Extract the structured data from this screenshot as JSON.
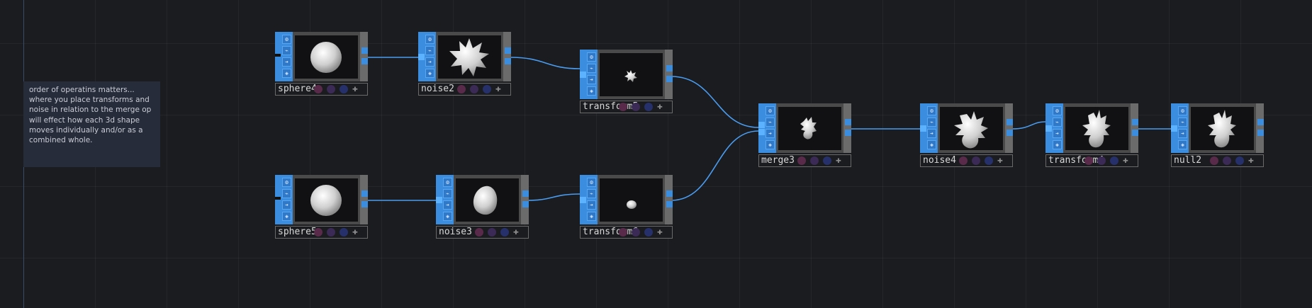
{
  "comment": {
    "text": "order of operatins matters... where you place transforms and noise in relation to the merge op will effect how each 3d shape moves individually and/or as a combined whole."
  },
  "nodes": [
    {
      "id": "sphere4",
      "name": "sphere4",
      "preview": "sphere-large",
      "ports_in": 0
    },
    {
      "id": "noise2",
      "name": "noise2",
      "preview": "spiky-blob-large",
      "ports_in": 1
    },
    {
      "id": "transform5",
      "name": "transform5",
      "preview": "spiky-blob-small",
      "ports_in": 1
    },
    {
      "id": "sphere5",
      "name": "sphere5",
      "preview": "sphere-large",
      "ports_in": 0
    },
    {
      "id": "noise3",
      "name": "noise3",
      "preview": "smooth-blob",
      "ports_in": 1
    },
    {
      "id": "transform6",
      "name": "transform6",
      "preview": "smooth-blob-small",
      "ports_in": 1
    },
    {
      "id": "merge3",
      "name": "merge3",
      "preview": "merged-small",
      "ports_in": 2
    },
    {
      "id": "noise4",
      "name": "noise4",
      "preview": "merged-spiky",
      "ports_in": 1
    },
    {
      "id": "transform4",
      "name": "transform4",
      "preview": "merged-spiky-tall",
      "ports_in": 1
    },
    {
      "id": "null2",
      "name": "null2",
      "preview": "merged-spiky-tall",
      "ports_in": 1
    }
  ],
  "connections": [
    {
      "from": "sphere4",
      "to": "noise2"
    },
    {
      "from": "noise2",
      "to": "transform5"
    },
    {
      "from": "transform5",
      "to": "merge3"
    },
    {
      "from": "sphere5",
      "to": "noise3"
    },
    {
      "from": "noise3",
      "to": "transform6"
    },
    {
      "from": "transform6",
      "to": "merge3"
    },
    {
      "from": "merge3",
      "to": "noise4"
    },
    {
      "from": "noise4",
      "to": "transform4"
    },
    {
      "from": "transform4",
      "to": "null2"
    }
  ],
  "colors": {
    "background": "#1b1c20",
    "accent": "#3b8de0",
    "wire": "#4a9cf0",
    "comment_bg": "#272c3b"
  },
  "icons": {
    "side": [
      "gear-icon",
      "wand-icon",
      "arrow-right-icon",
      "cube-icon"
    ],
    "flags": [
      "bypass-flag-icon",
      "lock-flag-icon",
      "display-flag-icon",
      "add-icon"
    ]
  }
}
